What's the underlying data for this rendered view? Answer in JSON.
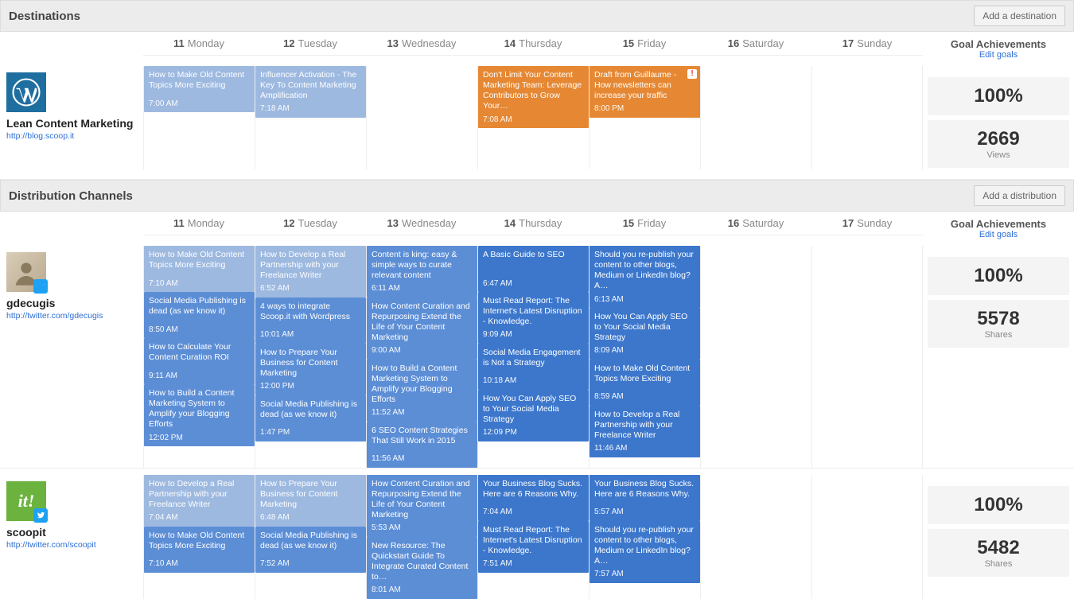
{
  "days": [
    {
      "num": "11",
      "name": "Monday"
    },
    {
      "num": "12",
      "name": "Tuesday"
    },
    {
      "num": "13",
      "name": "Wednesday"
    },
    {
      "num": "14",
      "name": "Thursday"
    },
    {
      "num": "15",
      "name": "Friday"
    },
    {
      "num": "16",
      "name": "Saturday"
    },
    {
      "num": "17",
      "name": "Sunday"
    }
  ],
  "goal_header": "Goal Achievements",
  "edit_goals": "Edit goals",
  "sections": {
    "destinations": {
      "title": "Destinations",
      "add_label": "Add a destination"
    },
    "distribution": {
      "title": "Distribution Channels",
      "add_label": "Add a distribution"
    }
  },
  "dest": {
    "profile": {
      "name": "Lean Content Marketing",
      "url": "http://blog.scoop.it",
      "icon": "wordpress"
    },
    "goals": {
      "pct": "100%",
      "value": "2669",
      "label": "Views"
    },
    "cards": {
      "mon": [
        {
          "t": "How to Make Old Content Topics More Exciting",
          "time": "7:00 AM",
          "c": "c-lightblue"
        }
      ],
      "tue": [
        {
          "t": "Influencer Activation - The Key To Content Marketing Amplification",
          "time": "7:18 AM",
          "c": "c-lightblue"
        }
      ],
      "wed": [],
      "thu": [
        {
          "t": "Don't Limit Your Content Marketing Team: Leverage Contributors to Grow Your…",
          "time": "7:08 AM",
          "c": "c-orange"
        }
      ],
      "fri": [
        {
          "t": "Draft from Guillaume - How newsletters can increase your traffic",
          "time": "8:00 PM",
          "c": "c-orange",
          "alert": true
        }
      ],
      "sat": [],
      "sun": []
    }
  },
  "dist1": {
    "profile": {
      "name": "gdecugis",
      "url": "http://twitter.com/gdecugis",
      "icon": "avatar"
    },
    "goals": {
      "pct": "100%",
      "value": "5578",
      "label": "Shares"
    },
    "cards": {
      "mon": [
        {
          "t": "How to Make Old Content Topics More Exciting",
          "time": "7:10 AM",
          "c": "c-lightblue"
        },
        {
          "t": "Social Media Publishing is dead (as we know it)",
          "time": "8:50 AM",
          "c": "c-blue"
        },
        {
          "t": "How to Calculate Your Content Curation ROI",
          "time": "9:11 AM",
          "c": "c-blue"
        },
        {
          "t": "How to Build a Content Marketing System to Amplify your Blogging Efforts",
          "time": "12:02 PM",
          "c": "c-blue"
        }
      ],
      "tue": [
        {
          "t": "How to Develop a Real Partnership with your Freelance Writer",
          "time": "6:52 AM",
          "c": "c-lightblue"
        },
        {
          "t": "4 ways to integrate Scoop.it with Wordpress",
          "time": "10:01 AM",
          "c": "c-blue"
        },
        {
          "t": "How to Prepare Your Business for Content Marketing",
          "time": "12:00 PM",
          "c": "c-blue"
        },
        {
          "t": "Social Media Publishing is dead (as we know it)",
          "time": "1:47 PM",
          "c": "c-blue"
        }
      ],
      "wed": [
        {
          "t": "Content is king: easy & simple ways to curate relevant content",
          "time": "6:11 AM",
          "c": "c-blue"
        },
        {
          "t": "How Content Curation and Repurposing Extend the Life of Your Content Marketing",
          "time": "9:00 AM",
          "c": "c-blue"
        },
        {
          "t": "How to Build a Content Marketing System to Amplify your Blogging Efforts",
          "time": "11:52 AM",
          "c": "c-blue"
        },
        {
          "t": "6 SEO Content Strategies That Still Work in 2015",
          "time": "11:56 AM",
          "c": "c-blue"
        }
      ],
      "thu": [
        {
          "t": "A Basic Guide to SEO",
          "time": "6:47 AM",
          "c": "c-darkblue"
        },
        {
          "t": "Must Read Report: The Internet's Latest Disruption - Knowledge.",
          "time": "9:09 AM",
          "c": "c-darkblue"
        },
        {
          "t": "Social Media Engagement is Not a Strategy",
          "time": "10:18 AM",
          "c": "c-darkblue"
        },
        {
          "t": "How You Can Apply SEO to Your Social Media Strategy",
          "time": "12:09 PM",
          "c": "c-darkblue"
        }
      ],
      "fri": [
        {
          "t": "Should you re-publish your content to other blogs, Medium or LinkedIn blog? A…",
          "time": "6:13 AM",
          "c": "c-darkblue"
        },
        {
          "t": "How You Can Apply SEO to Your Social Media Strategy",
          "time": "8:09 AM",
          "c": "c-darkblue"
        },
        {
          "t": "How to Make Old Content Topics More Exciting",
          "time": "8:59 AM",
          "c": "c-darkblue"
        },
        {
          "t": "How to Develop a Real Partnership with your Freelance Writer",
          "time": "11:46 AM",
          "c": "c-darkblue"
        }
      ],
      "sat": [],
      "sun": []
    }
  },
  "dist2": {
    "profile": {
      "name": "scoopit",
      "url": "http://twitter.com/scoopit",
      "icon": "scoopit"
    },
    "goals": {
      "pct": "100%",
      "value": "5482",
      "label": "Shares"
    },
    "cards": {
      "mon": [
        {
          "t": "How to Develop a Real Partnership with your Freelance Writer",
          "time": "7:04 AM",
          "c": "c-lightblue"
        },
        {
          "t": "How to Make Old Content Topics More Exciting",
          "time": "7:10 AM",
          "c": "c-blue"
        }
      ],
      "tue": [
        {
          "t": "How to Prepare Your Business for Content Marketing",
          "time": "6:48 AM",
          "c": "c-lightblue"
        },
        {
          "t": "Social Media Publishing is dead (as we know it)",
          "time": "7:52 AM",
          "c": "c-blue"
        }
      ],
      "wed": [
        {
          "t": "How Content Curation and Repurposing Extend the Life of Your Content Marketing",
          "time": "5:53 AM",
          "c": "c-blue"
        },
        {
          "t": "New Resource: The Quickstart Guide To Integrate Curated Content to…",
          "time": "8:01 AM",
          "c": "c-blue"
        }
      ],
      "thu": [
        {
          "t": "Your Business Blog Sucks. Here are 6 Reasons Why.",
          "time": "7:04 AM",
          "c": "c-darkblue"
        },
        {
          "t": "Must Read Report: The Internet's Latest Disruption - Knowledge.",
          "time": "7:51 AM",
          "c": "c-darkblue"
        }
      ],
      "fri": [
        {
          "t": "Your Business Blog Sucks. Here are 6 Reasons Why.",
          "time": "5:57 AM",
          "c": "c-darkblue"
        },
        {
          "t": "Should you re-publish your content to other blogs, Medium or LinkedIn blog? A…",
          "time": "7:57 AM",
          "c": "c-darkblue"
        }
      ],
      "sat": [],
      "sun": []
    }
  }
}
